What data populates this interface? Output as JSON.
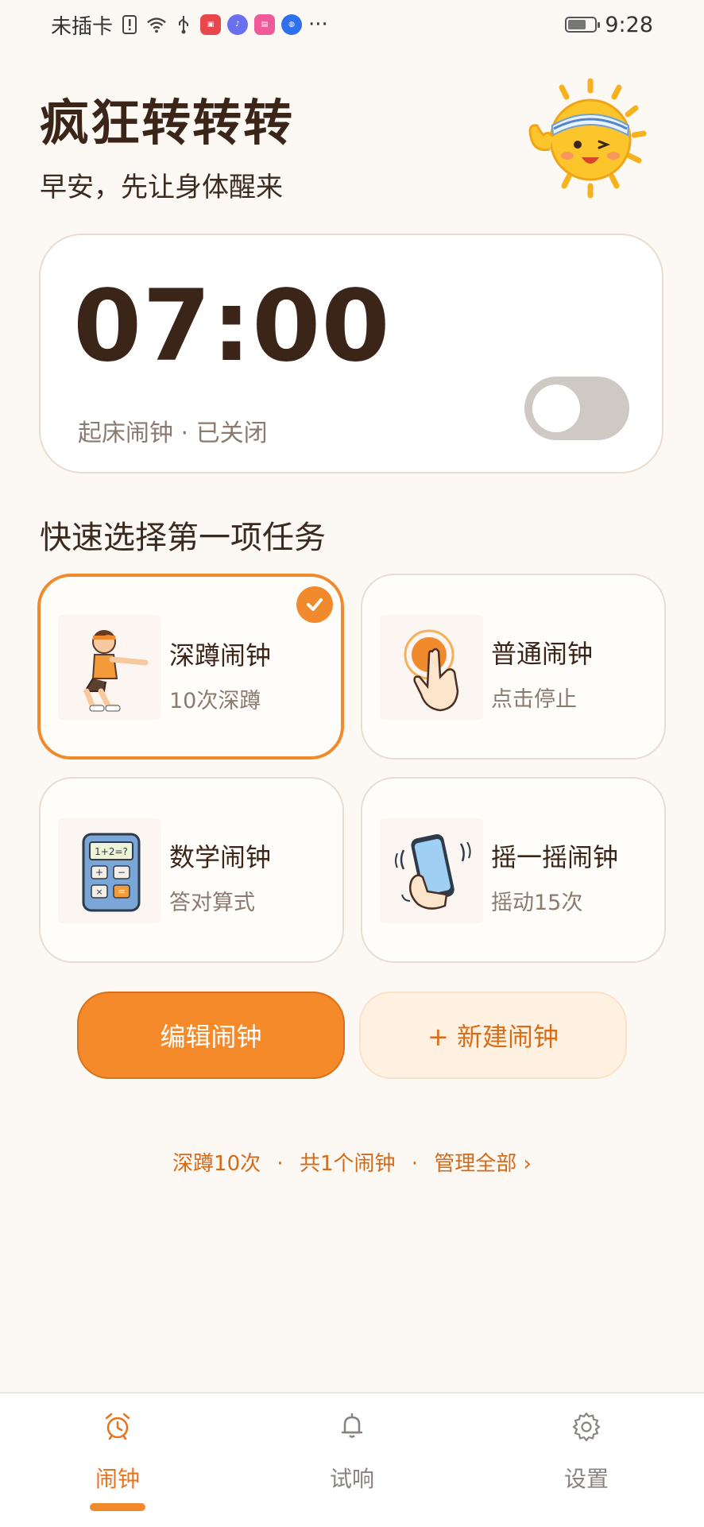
{
  "status_bar": {
    "carrier": "未插卡",
    "time": "9:28",
    "more": "···"
  },
  "header": {
    "title": "疯狂转转转",
    "subtitle": "早安，先让身体醒来"
  },
  "alarm": {
    "time": "07:00",
    "label": "起床闹钟 · 已关闭",
    "enabled": false
  },
  "quick_tasks": {
    "title": "快速选择第一项任务",
    "items": [
      {
        "name": "深蹲闹钟",
        "desc": "10次深蹲",
        "selected": true,
        "icon": "squat-icon"
      },
      {
        "name": "普通闹钟",
        "desc": "点击停止",
        "selected": false,
        "icon": "tap-icon"
      },
      {
        "name": "数学闹钟",
        "desc": "答对算式",
        "selected": false,
        "icon": "calculator-icon"
      },
      {
        "name": "摇一摇闹钟",
        "desc": "摇动15次",
        "selected": false,
        "icon": "shake-phone-icon"
      }
    ]
  },
  "actions": {
    "edit": "编辑闹钟",
    "new": "+ 新建闹钟"
  },
  "summary": {
    "squat": "深蹲10次",
    "count": "共1个闹钟",
    "manage": "管理全部 ›",
    "separator": "·"
  },
  "bottom_nav": {
    "items": [
      {
        "label": "闹钟",
        "icon": "alarm-clock-icon",
        "active": true
      },
      {
        "label": "试响",
        "icon": "bell-icon",
        "active": false
      },
      {
        "label": "设置",
        "icon": "gear-icon",
        "active": false
      }
    ]
  },
  "colors": {
    "accent": "#f08a2c",
    "background": "#fcf8f4",
    "title": "#3b2418",
    "muted": "#8a7a70"
  }
}
